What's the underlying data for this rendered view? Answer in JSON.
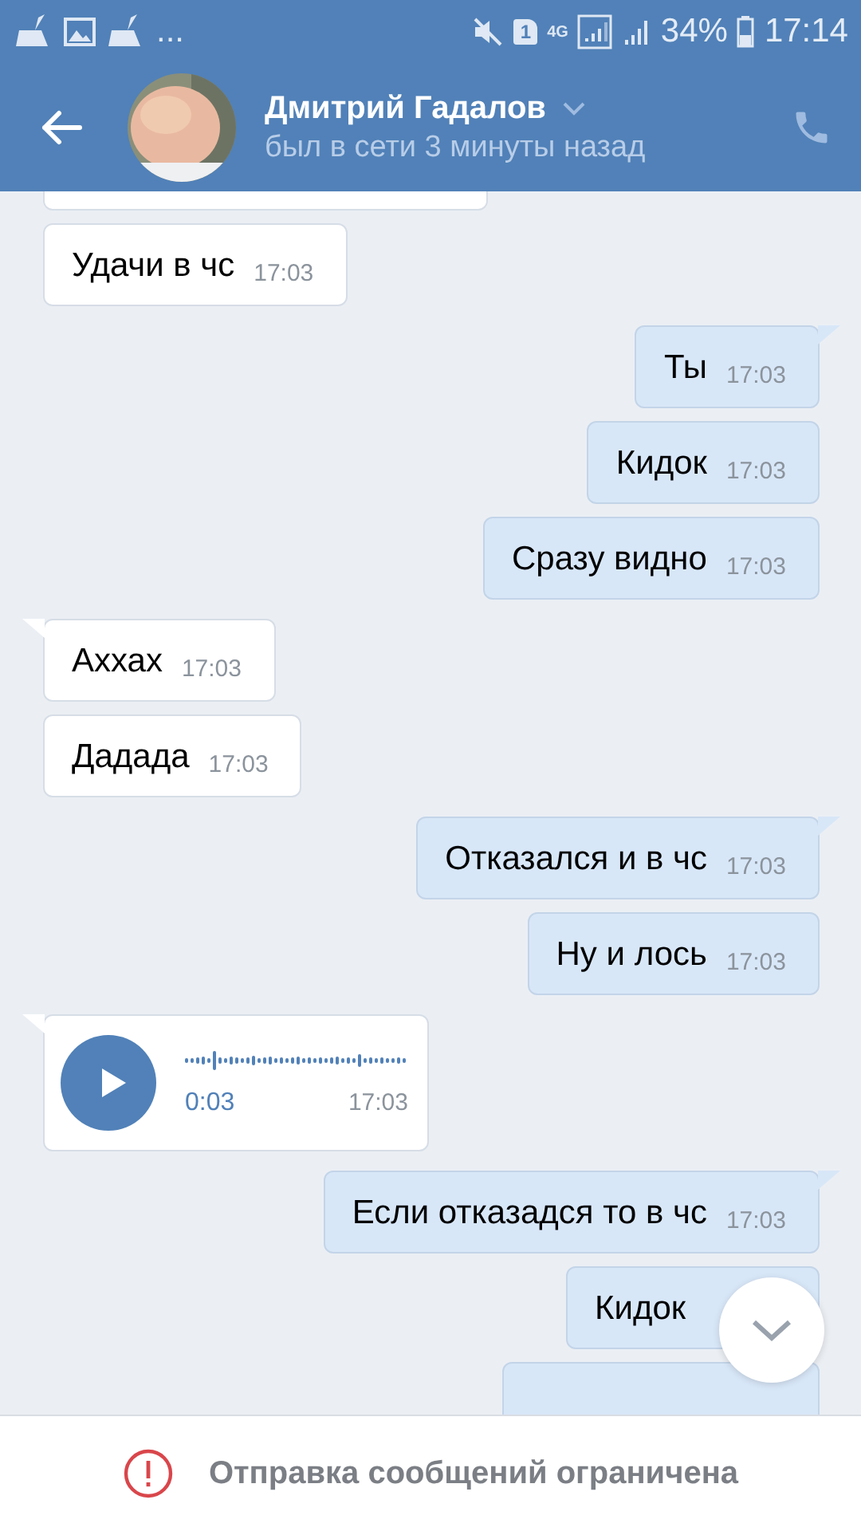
{
  "status_bar": {
    "more": "...",
    "sim": "1",
    "network": "4G",
    "battery": "34%",
    "time": "17:14"
  },
  "header": {
    "name": "Дмитрий Гадалов",
    "status": "был в сети 3 минуты назад"
  },
  "messages": [
    {
      "outgoing": false,
      "kind": "partial",
      "tail": false
    },
    {
      "outgoing": false,
      "kind": "text",
      "tail": false,
      "text": "Удачи в чс",
      "time": "17:03"
    },
    {
      "outgoing": true,
      "kind": "text",
      "tail": true,
      "text": "Ты",
      "time": "17:03"
    },
    {
      "outgoing": true,
      "kind": "text",
      "tail": false,
      "text": "Кидок",
      "time": "17:03"
    },
    {
      "outgoing": true,
      "kind": "text",
      "tail": false,
      "text": "Сразу видно",
      "time": "17:03"
    },
    {
      "outgoing": false,
      "kind": "text",
      "tail": true,
      "text": "Аххах",
      "time": "17:03"
    },
    {
      "outgoing": false,
      "kind": "text",
      "tail": false,
      "text": "Дадада",
      "time": "17:03"
    },
    {
      "outgoing": true,
      "kind": "text",
      "tail": true,
      "text": "Отказался и в чс",
      "time": "17:03"
    },
    {
      "outgoing": true,
      "kind": "text",
      "tail": false,
      "text": "Ну и лось",
      "time": "17:03"
    },
    {
      "outgoing": false,
      "kind": "voice",
      "tail": true,
      "duration": "0:03",
      "time": "17:03"
    },
    {
      "outgoing": true,
      "kind": "text",
      "tail": true,
      "text": "Если отказадся то в чс",
      "time": "17:03"
    },
    {
      "outgoing": true,
      "kind": "covered",
      "tail": false,
      "text": "Кидок"
    },
    {
      "outgoing": true,
      "kind": "partial",
      "tail": false
    }
  ],
  "notice": {
    "text": "Отправка сообщений ограничена"
  }
}
